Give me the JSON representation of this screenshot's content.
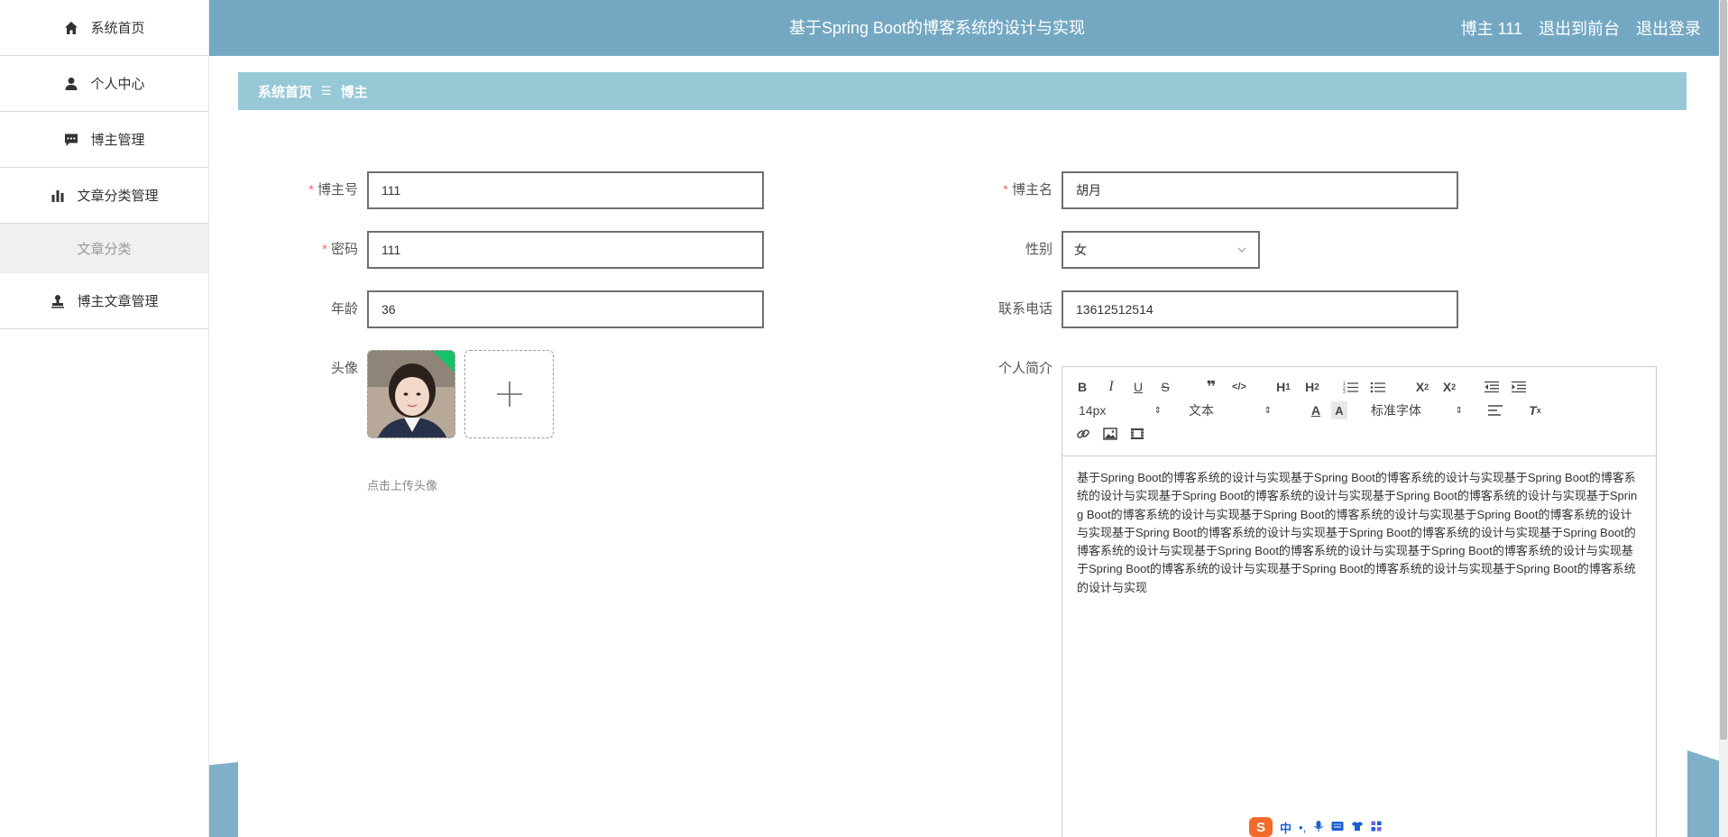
{
  "sidebar": {
    "items": [
      {
        "label": "系统首页",
        "icon": "home-icon"
      },
      {
        "label": "个人中心",
        "icon": "user-icon"
      },
      {
        "label": "博主管理",
        "icon": "chat-icon"
      },
      {
        "label": "文章分类管理",
        "icon": "bar-chart-icon"
      },
      {
        "label": "文章分类",
        "icon": ""
      },
      {
        "label": "博主文章管理",
        "icon": "stamp-icon"
      }
    ]
  },
  "header": {
    "title": "基于Spring Boot的博客系统的设计与实现",
    "user": "博主 111",
    "exit_front": "退出到前台",
    "logout": "退出登录"
  },
  "breadcrumb": {
    "home": "系统首页",
    "separator": "☰",
    "current": "博主"
  },
  "form": {
    "blogger_no": {
      "label": "博主号",
      "value": "111",
      "required": true
    },
    "blogger_name": {
      "label": "博主名",
      "value": "胡月",
      "required": true
    },
    "password": {
      "label": "密码",
      "value": "111",
      "required": true
    },
    "gender": {
      "label": "性别",
      "value": "女"
    },
    "age": {
      "label": "年龄",
      "value": "36"
    },
    "phone": {
      "label": "联系电话",
      "value": "13612512514"
    },
    "avatar": {
      "label": "头像",
      "tip": "点击上传头像"
    },
    "bio": {
      "label": "个人简介"
    }
  },
  "editor": {
    "toolbar": {
      "font_size": "14px",
      "text_type": "文本",
      "font_family": "标准字体"
    },
    "content": "基于Spring Boot的博客系统的设计与实现基于Spring Boot的博客系统的设计与实现基于Spring Boot的博客系统的设计与实现基于Spring Boot的博客系统的设计与实现基于Spring Boot的博客系统的设计与实现基于Spring Boot的博客系统的设计与实现基于Spring Boot的博客系统的设计与实现基于Spring Boot的博客系统的设计与实现基于Spring Boot的博客系统的设计与实现基于Spring Boot的博客系统的设计与实现基于Spring Boot的博客系统的设计与实现基于Spring Boot的博客系统的设计与实现基于Spring Boot的博客系统的设计与实现基于Spring Boot的博客系统的设计与实现基于Spring Boot的博客系统的设计与实现基于Spring Boot的博客系统的设计与实现"
  },
  "ime": {
    "mode": "中"
  },
  "colors": {
    "header_bg": "#74a8c2",
    "breadcrumb_bg": "#97c8d6",
    "required": "#f56c6c"
  }
}
